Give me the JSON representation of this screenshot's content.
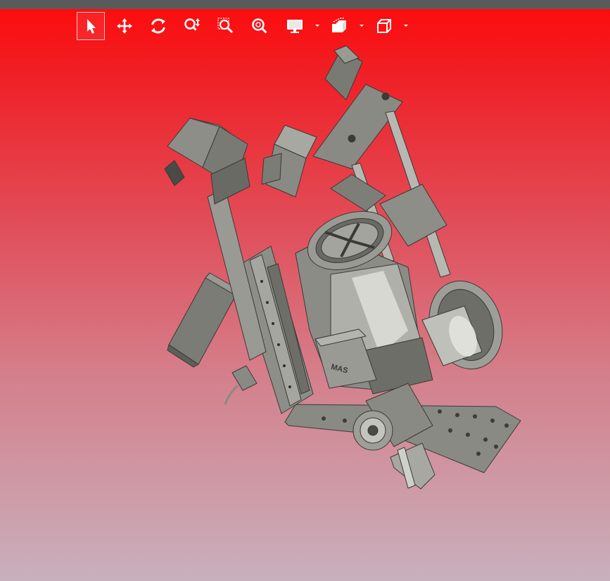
{
  "toolbar": {
    "tools": [
      {
        "icon": "select-arrow-icon",
        "active": true
      },
      {
        "icon": "pan-icon"
      },
      {
        "icon": "rotate-icon"
      },
      {
        "icon": "zoom-icon"
      },
      {
        "icon": "zoom-window-icon"
      },
      {
        "icon": "zoom-fit-icon"
      },
      {
        "icon": "display-mode-icon",
        "dropdown": true
      },
      {
        "icon": "section-view-icon",
        "dropdown": true
      },
      {
        "icon": "view-cube-icon",
        "dropdown": true
      }
    ]
  },
  "model": {
    "motor_label": "MAS"
  },
  "colors": {
    "background_top": "#ff0a0a",
    "background_bottom": "#c8b0bc",
    "titlebar": "#5a5a5a",
    "icon": "#ffffff",
    "metal": "#8a8a84"
  }
}
